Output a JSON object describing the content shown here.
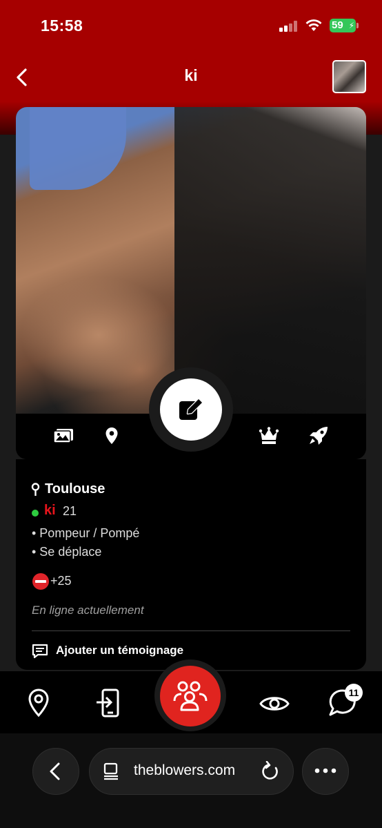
{
  "status_bar": {
    "time": "15:58",
    "battery": "59"
  },
  "header": {
    "title": "ki"
  },
  "profile": {
    "city": "Toulouse",
    "username": "ki",
    "age": "21",
    "tags": [
      "• Pompeur / Pompé",
      "• Se déplace"
    ],
    "age_range": "+25",
    "presence": "En ligne actuellement",
    "add_testimony": "Ajouter un témoignage"
  },
  "tab_bar": {
    "messages_badge": "11"
  },
  "browser": {
    "url": "theblowers.com"
  },
  "icons": {
    "back": "chevron-left-icon",
    "photos": "gallery-icon",
    "location": "map-pin-icon",
    "edit": "edit-icon",
    "premium": "crown-icon",
    "boost": "rocket-icon",
    "testimony": "message-square-icon",
    "tab_map": "map-pin-icon",
    "tab_login": "login-icon",
    "tab_people": "users-icon",
    "tab_visits": "eye-icon",
    "tab_messages": "chat-icon"
  },
  "colors": {
    "brand_red": "#a60000",
    "accent_red": "#e0241f",
    "online_green": "#2ecc40"
  }
}
